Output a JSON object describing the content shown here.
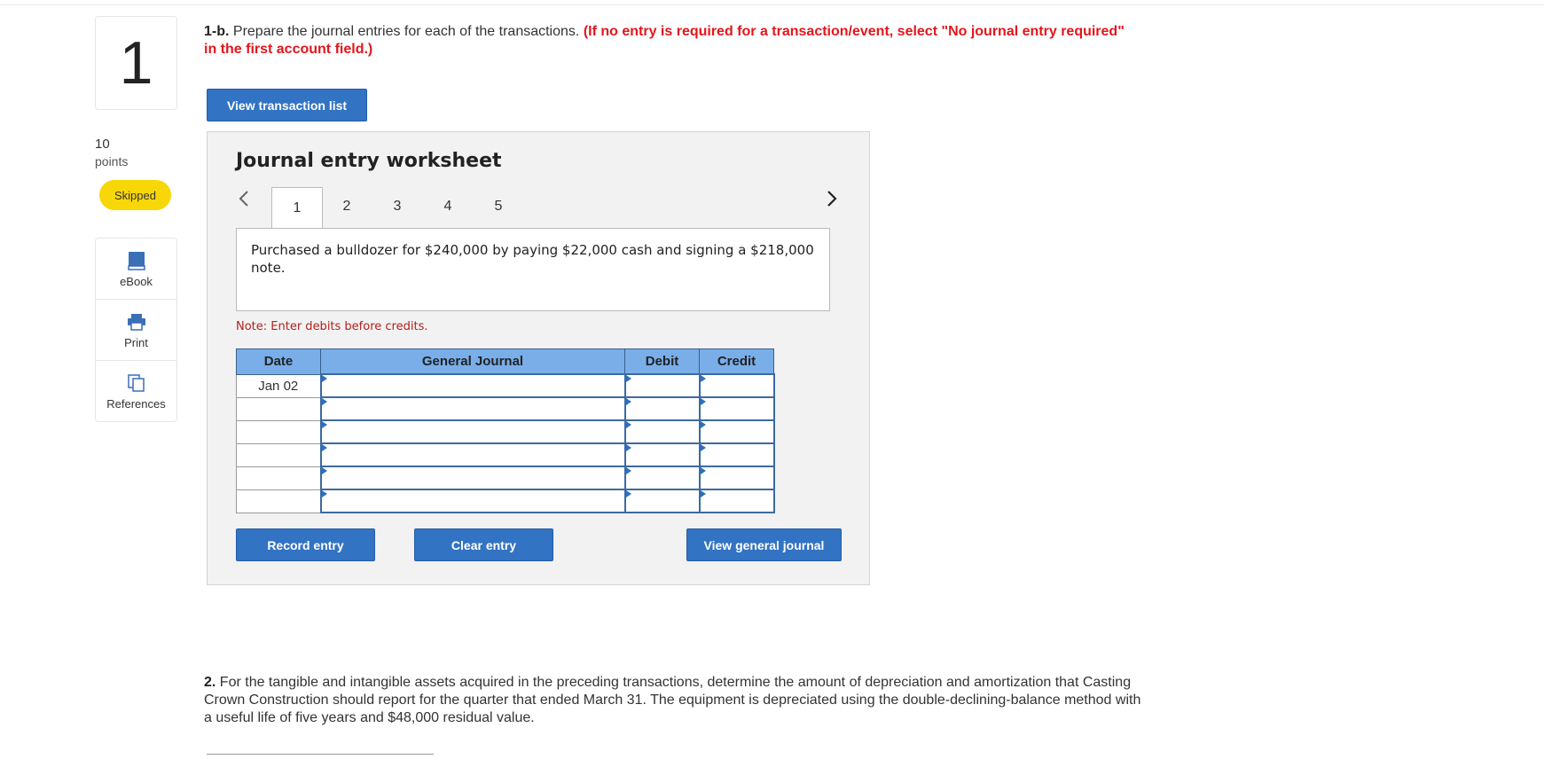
{
  "question": {
    "number": "1",
    "points_value": "10",
    "points_label": "points",
    "status_badge": "Skipped"
  },
  "tools": [
    {
      "label": "eBook",
      "icon": "book-icon"
    },
    {
      "label": "Print",
      "icon": "printer-icon"
    },
    {
      "label": "References",
      "icon": "references-icon"
    }
  ],
  "prompt": {
    "part_label": "1-b.",
    "text": "Prepare the journal entries for each of the transactions.",
    "instruction": "(If no entry is required for a transaction/event, select \"No journal entry required\" in the first account field.)"
  },
  "view_transaction_list_label": "View transaction list",
  "worksheet": {
    "title": "Journal entry worksheet",
    "tabs": [
      "1",
      "2",
      "3",
      "4",
      "5"
    ],
    "active_tab": "1",
    "description": "Purchased a bulldozer for $240,000 by paying $22,000 cash and signing a $218,000 note.",
    "note": "Note: Enter debits before credits.",
    "table": {
      "headers": {
        "date": "Date",
        "journal": "General Journal",
        "debit": "Debit",
        "credit": "Credit"
      },
      "rows": [
        {
          "date": "Jan 02",
          "account": "",
          "debit": "",
          "credit": ""
        },
        {
          "date": "",
          "account": "",
          "debit": "",
          "credit": ""
        },
        {
          "date": "",
          "account": "",
          "debit": "",
          "credit": ""
        },
        {
          "date": "",
          "account": "",
          "debit": "",
          "credit": ""
        },
        {
          "date": "",
          "account": "",
          "debit": "",
          "credit": ""
        },
        {
          "date": "",
          "account": "",
          "debit": "",
          "credit": ""
        }
      ]
    },
    "buttons": {
      "record": "Record entry",
      "clear": "Clear entry",
      "view_general_journal": "View general journal"
    }
  },
  "part2": {
    "label": "2.",
    "text": "For the tangible and intangible assets acquired in the preceding transactions, determine the amount of depreciation and amortization that Casting Crown Construction should report for the quarter that ended March 31. The equipment is depreciated using the double-declining-balance method with a useful life of five years and $48,000 residual value."
  },
  "colors": {
    "accent_blue": "#3273c3",
    "header_blue": "#79aee9",
    "instruction_red": "#e3161c",
    "badge_yellow": "#f8d708"
  }
}
